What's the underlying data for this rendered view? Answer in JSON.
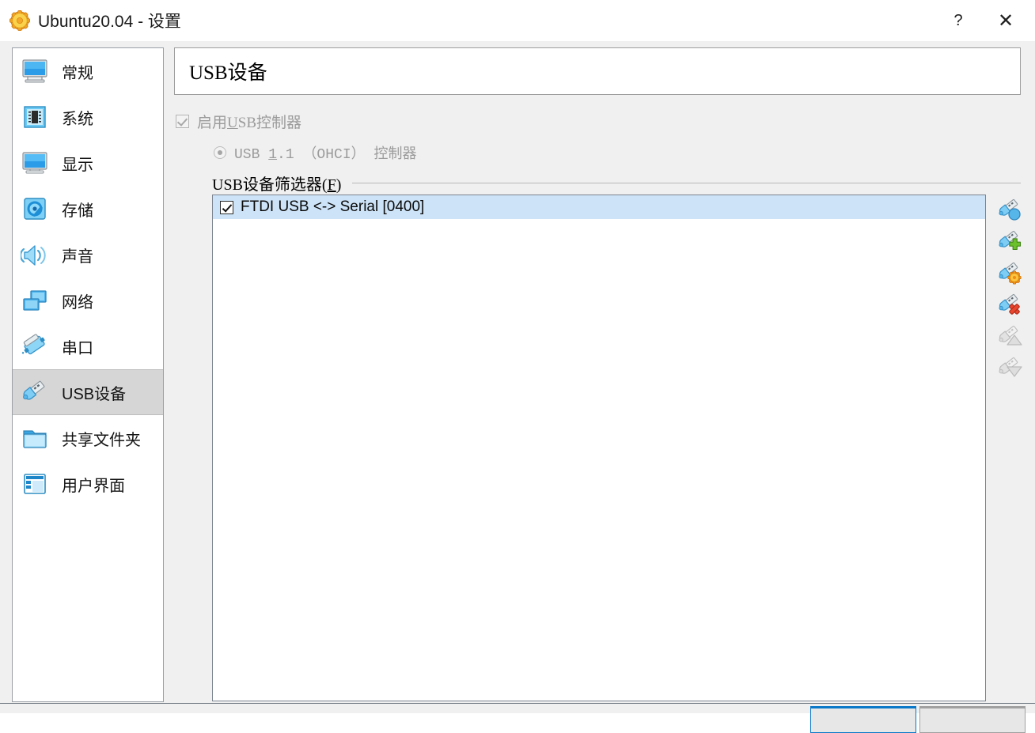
{
  "window": {
    "title": "Ubuntu20.04 - 设置",
    "icon": "settings-gear-icon",
    "help_label": "?",
    "close_label": "✕"
  },
  "sidebar": {
    "items": [
      {
        "label": "常规",
        "icon": "monitor-general-icon",
        "selected": false
      },
      {
        "label": "系统",
        "icon": "chip-system-icon",
        "selected": false
      },
      {
        "label": "显示",
        "icon": "monitor-display-icon",
        "selected": false
      },
      {
        "label": "存储",
        "icon": "harddisk-storage-icon",
        "selected": false
      },
      {
        "label": "声音",
        "icon": "speaker-audio-icon",
        "selected": false
      },
      {
        "label": "网络",
        "icon": "network-cards-icon",
        "selected": false
      },
      {
        "label": "串口",
        "icon": "serial-port-icon",
        "selected": false
      },
      {
        "label": "USB设备",
        "icon": "usb-device-icon",
        "selected": true
      },
      {
        "label": "共享文件夹",
        "icon": "folder-shared-icon",
        "selected": false
      },
      {
        "label": "用户界面",
        "icon": "window-ui-icon",
        "selected": false
      }
    ]
  },
  "main": {
    "page_title": "USB设备",
    "enable_usb": {
      "label_before": "启用",
      "label_accel": "U",
      "label_after": "SB控制器",
      "checked": true,
      "enabled": false
    },
    "controller_radio": {
      "label_before": "USB ",
      "label_accel": "1",
      "label_after": ".1 （OHCI） 控制器",
      "selected": true,
      "enabled": false
    },
    "filters_group": {
      "label_before": "USB设备筛选器(",
      "label_accel": "F",
      "label_after": ")"
    },
    "filters": [
      {
        "name": "FTDI USB <-> Serial [0400]",
        "checked": true,
        "selected": true
      }
    ],
    "toolbar": [
      {
        "name": "add-filter-from-device-button",
        "icon": "usb-from-device-icon",
        "enabled": true
      },
      {
        "name": "add-empty-filter-button",
        "icon": "usb-plus-icon",
        "enabled": true
      },
      {
        "name": "edit-filter-button",
        "icon": "usb-gear-icon",
        "enabled": true
      },
      {
        "name": "remove-filter-button",
        "icon": "usb-remove-icon",
        "enabled": true
      },
      {
        "name": "move-filter-up-button",
        "icon": "usb-move-up-icon",
        "enabled": false
      },
      {
        "name": "move-filter-down-button",
        "icon": "usb-move-down-icon",
        "enabled": false
      }
    ]
  },
  "footer": {
    "ok_button": "",
    "cancel_button": ""
  },
  "colors": {
    "accent": "#0a78c8",
    "selection": "#cde3f7",
    "sidebar_selected": "#d6d6d6",
    "page_background": "#f0f0f0",
    "disabled_text": "#9b9b9b"
  }
}
